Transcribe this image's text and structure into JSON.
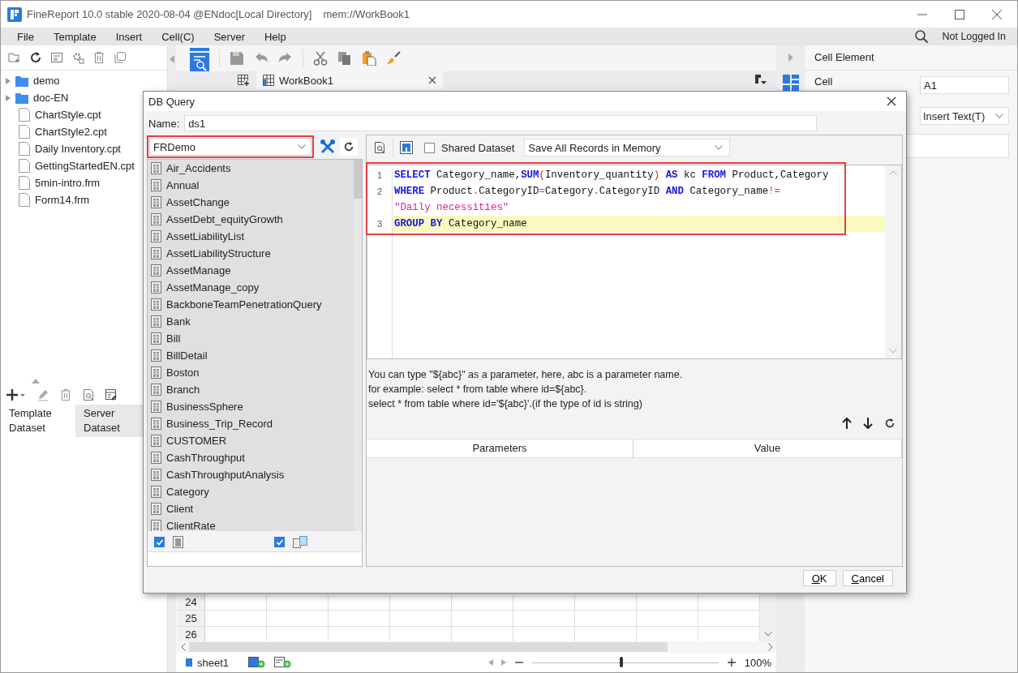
{
  "window": {
    "title": "FineReport 10.0 stable 2020-08-04 @ENdoc[Local Directory]",
    "path": "mem://WorkBook1"
  },
  "menu": [
    "File",
    "Template",
    "Insert",
    "Cell(C)",
    "Server",
    "Help"
  ],
  "account": "Not Logged In",
  "file_tree": [
    {
      "label": "demo",
      "kind": "folder"
    },
    {
      "label": "doc-EN",
      "kind": "folder"
    },
    {
      "label": "ChartStyle.cpt",
      "kind": "file"
    },
    {
      "label": "ChartStyle2.cpt",
      "kind": "file"
    },
    {
      "label": "Daily Inventory.cpt",
      "kind": "file"
    },
    {
      "label": "GettingStartedEN.cpt",
      "kind": "file"
    },
    {
      "label": "5min-intro.frm",
      "kind": "file"
    },
    {
      "label": "Form14.frm",
      "kind": "file"
    }
  ],
  "dataset_tabs": [
    {
      "label": "Template Dataset",
      "selected": true
    },
    {
      "label": "Server Dataset",
      "selected": false
    }
  ],
  "editor_tabs": [
    "WorkBook1"
  ],
  "grid_rows": [
    "24",
    "25",
    "26"
  ],
  "sheet_bar": {
    "sheets": [
      "sheet1"
    ],
    "zoom": {
      "level": 0.48,
      "reading": "100%"
    }
  },
  "property_panel": {
    "title": "Cell Element",
    "cell_label": "Cell",
    "cell_value": "A1",
    "insert_type": "Insert Text(T)"
  },
  "dialog": {
    "title": "DB Query",
    "name_label": "Name:",
    "name_value": "ds1",
    "connection": "FRDemo",
    "connection_highlighted": true,
    "tables": [
      "Air_Accidents",
      "Annual",
      "AssetChange",
      "AssetDebt_equityGrowth",
      "AssetLiabilityList",
      "AssetLiabilityStructure",
      "AssetManage",
      "AssetManage_copy",
      "BackboneTeamPenetrationQuery",
      "Bank",
      "Bill",
      "BillDetail",
      "Boston",
      "Branch",
      "BusinessSphere",
      "Business_Trip_Record",
      "CUSTOMER",
      "CashThroughput",
      "CashThroughputAnalysis",
      "Category",
      "Client",
      "ClientRate"
    ],
    "show_tables": {
      "checked": true
    },
    "show_views": {
      "checked": true
    },
    "shared_dataset": {
      "label": "Shared Dataset",
      "checked": false
    },
    "memory_mode": "Save All Records in Memory",
    "sql_highlighted": true,
    "sql_lines": [
      {
        "number": "1",
        "highlighted": false,
        "rows": [
          [
            {
              "kind": "kw",
              "text": "SELECT"
            },
            {
              "kind": "plain",
              "text": " Category_name,"
            },
            {
              "kind": "kw",
              "text": "SUM"
            },
            {
              "kind": "paren",
              "text": "("
            },
            {
              "kind": "plain",
              "text": "Inventory_quantity"
            },
            {
              "kind": "paren",
              "text": ")"
            },
            {
              "kind": "plain",
              "text": " "
            },
            {
              "kind": "kw",
              "text": "AS"
            },
            {
              "kind": "plain",
              "text": " kc "
            },
            {
              "kind": "kw",
              "text": "FROM"
            },
            {
              "kind": "plain",
              "text": " Product,Category"
            }
          ]
        ]
      },
      {
        "number": "2",
        "highlighted": false,
        "rows": [
          [
            {
              "kind": "kw",
              "text": "WHERE"
            },
            {
              "kind": "plain",
              "text": " Product"
            },
            {
              "kind": "op",
              "text": "."
            },
            {
              "kind": "plain",
              "text": "CategoryID"
            },
            {
              "kind": "op",
              "text": "="
            },
            {
              "kind": "plain",
              "text": "Category"
            },
            {
              "kind": "op",
              "text": "."
            },
            {
              "kind": "plain",
              "text": "CategoryID "
            },
            {
              "kind": "kw",
              "text": "AND"
            },
            {
              "kind": "plain",
              "text": " Category_name"
            },
            {
              "kind": "op",
              "text": "!="
            }
          ],
          [
            {
              "kind": "str",
              "text": "\"Daily necessities\""
            }
          ]
        ]
      },
      {
        "number": "3",
        "highlighted": true,
        "rows": [
          [
            {
              "kind": "kw",
              "text": "GROUP BY"
            },
            {
              "kind": "plain",
              "text": " Category_name"
            }
          ]
        ]
      }
    ],
    "hint": [
      "You can type \"${abc}\" as a parameter, here, abc is a parameter name.",
      "for example: select * from table where id=${abc}.",
      "select * from table where id='${abc}'.(if the type of id is string)"
    ],
    "parameter_columns": [
      "Parameters",
      "Value"
    ],
    "buttons": [
      "OK",
      "Cancel"
    ]
  }
}
